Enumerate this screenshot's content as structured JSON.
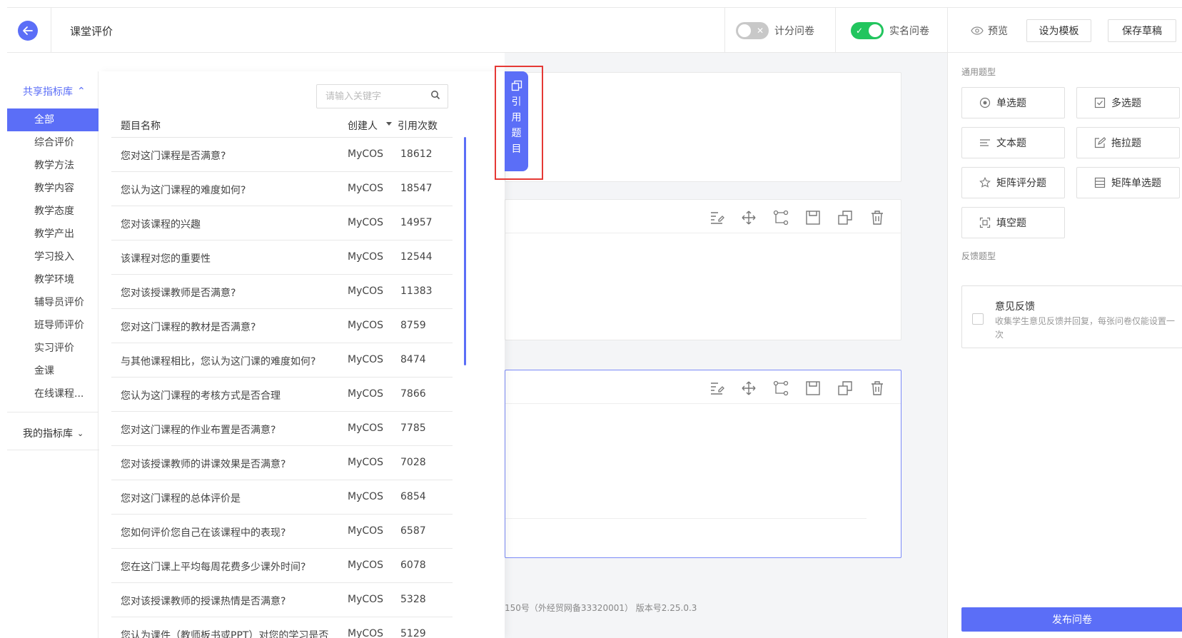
{
  "header": {
    "title": "课堂评价",
    "score_toggle": {
      "label": "计分问卷",
      "on": false
    },
    "realname_toggle": {
      "label": "实名问卷",
      "on": true
    },
    "preview_label": "预览",
    "template_button": "设为模板",
    "save_draft_button": "保存草稿"
  },
  "leftnav": {
    "shared_lib": "共享指标库",
    "categories": [
      "全部",
      "综合评价",
      "教学方法",
      "教学内容",
      "教学态度",
      "教学产出",
      "学习投入",
      "教学环境",
      "辅导员评价",
      "班导师评价",
      "实习评价",
      "金课",
      "在线课程..."
    ],
    "my_lib": "我的指标库"
  },
  "library": {
    "search_placeholder": "请输入关键字",
    "columns": {
      "name": "题目名称",
      "creator": "创建人",
      "count": "引用次数"
    },
    "rows": [
      {
        "name": "您对这门课程是否满意?",
        "creator": "MyCOS",
        "count": "18612"
      },
      {
        "name": "您认为这门课程的难度如何?",
        "creator": "MyCOS",
        "count": "18547"
      },
      {
        "name": "您对该课程的兴趣",
        "creator": "MyCOS",
        "count": "14957"
      },
      {
        "name": "该课程对您的重要性",
        "creator": "MyCOS",
        "count": "12544"
      },
      {
        "name": "您对该授课教师是否满意?",
        "creator": "MyCOS",
        "count": "11383"
      },
      {
        "name": "您对这门课程的教材是否满意?",
        "creator": "MyCOS",
        "count": "8759"
      },
      {
        "name": "与其他课程相比，您认为这门课的难度如何?",
        "creator": "MyCOS",
        "count": "8474"
      },
      {
        "name": "您认为这门课程的考核方式是否合理",
        "creator": "MyCOS",
        "count": "7866"
      },
      {
        "name": "您对这门课程的作业布置是否满意?",
        "creator": "MyCOS",
        "count": "7785"
      },
      {
        "name": "您对该授课教师的讲课效果是否满意?",
        "creator": "MyCOS",
        "count": "7028"
      },
      {
        "name": "您对这门课程的总体评价是",
        "creator": "MyCOS",
        "count": "6854"
      },
      {
        "name": "您如何评价您自己在该课程中的表现?",
        "creator": "MyCOS",
        "count": "6587"
      },
      {
        "name": "您在这门课上平均每周花费多少课外时间?",
        "creator": "MyCOS",
        "count": "6078"
      },
      {
        "name": "您对该授课教师的授课热情是否满意?",
        "creator": "MyCOS",
        "count": "5328"
      },
      {
        "name": "您认为课件（教师板书或PPT）对您的学习是否",
        "creator": "MyCOS",
        "count": "5129"
      }
    ]
  },
  "quote_tab": {
    "chars": [
      "引",
      "用",
      "题",
      "目"
    ]
  },
  "footer": {
    "text": "150号（外经贸网备33320001） 版本号2.25.0.3"
  },
  "rightpanel": {
    "general_label": "通用题型",
    "types": [
      {
        "label": "单选题",
        "icon": "radio-icon"
      },
      {
        "label": "多选题",
        "icon": "checkbox-icon"
      },
      {
        "label": "文本题",
        "icon": "text-lines-icon"
      },
      {
        "label": "拖拉题",
        "icon": "edit-square-icon"
      },
      {
        "label": "矩阵评分题",
        "icon": "star-icon"
      },
      {
        "label": "矩阵单选题",
        "icon": "matrix-icon"
      },
      {
        "label": "填空题",
        "icon": "fill-blank-icon"
      }
    ],
    "feedback_label": "反馈题型",
    "feedback": {
      "title": "意见反馈",
      "desc": "收集学生意见反馈并回复，每张问卷仅能设置一次"
    },
    "publish_button": "发布问卷"
  },
  "colors": {
    "primary": "#5b6ef7",
    "toggle_on": "#22c55e",
    "highlight_frame": "#e53935"
  }
}
